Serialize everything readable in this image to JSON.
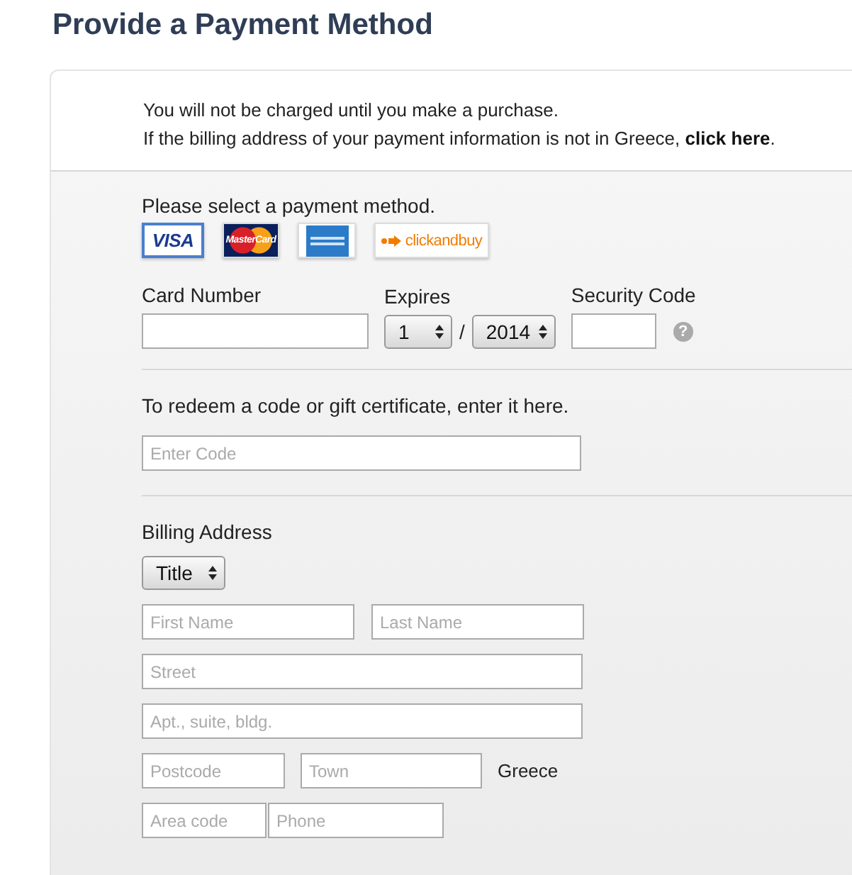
{
  "heading": "Provide a Payment Method",
  "notice": {
    "line1": "You will not be charged until you make a purchase.",
    "line2": "If the billing address of your payment information is not in Greece, ",
    "link": "click here",
    "line2_end": "."
  },
  "payment": {
    "prompt": "Please select a payment method.",
    "methods": [
      {
        "kind": "visa",
        "label": "VISA",
        "selected": true
      },
      {
        "kind": "mastercard",
        "label": "MasterCard",
        "selected": false
      },
      {
        "kind": "amex",
        "selected": false
      },
      {
        "kind": "clickandbuy",
        "label": "clickandbuy",
        "selected": false
      }
    ],
    "card_number_label": "Card Number",
    "expires_label": "Expires",
    "month": "1",
    "separator": "/",
    "year": "2014",
    "security_label": "Security Code",
    "help": "?"
  },
  "redeem": {
    "prompt": "To redeem a code or gift certificate, enter it here.",
    "placeholder": "Enter Code"
  },
  "billing": {
    "heading": "Billing Address",
    "title_select": "Title",
    "rows": [
      [
        {
          "placeholder": "First Name"
        },
        {
          "placeholder": "Last Name"
        }
      ],
      [
        {
          "placeholder": "Street"
        }
      ],
      [
        {
          "placeholder": "Apt., suite, bldg."
        }
      ]
    ],
    "postcode": {
      "placeholder": "Postcode"
    },
    "town": {
      "placeholder": "Town"
    },
    "country": "Greece",
    "area_code": {
      "placeholder": "Area code"
    },
    "phone": {
      "placeholder": "Phone"
    }
  }
}
